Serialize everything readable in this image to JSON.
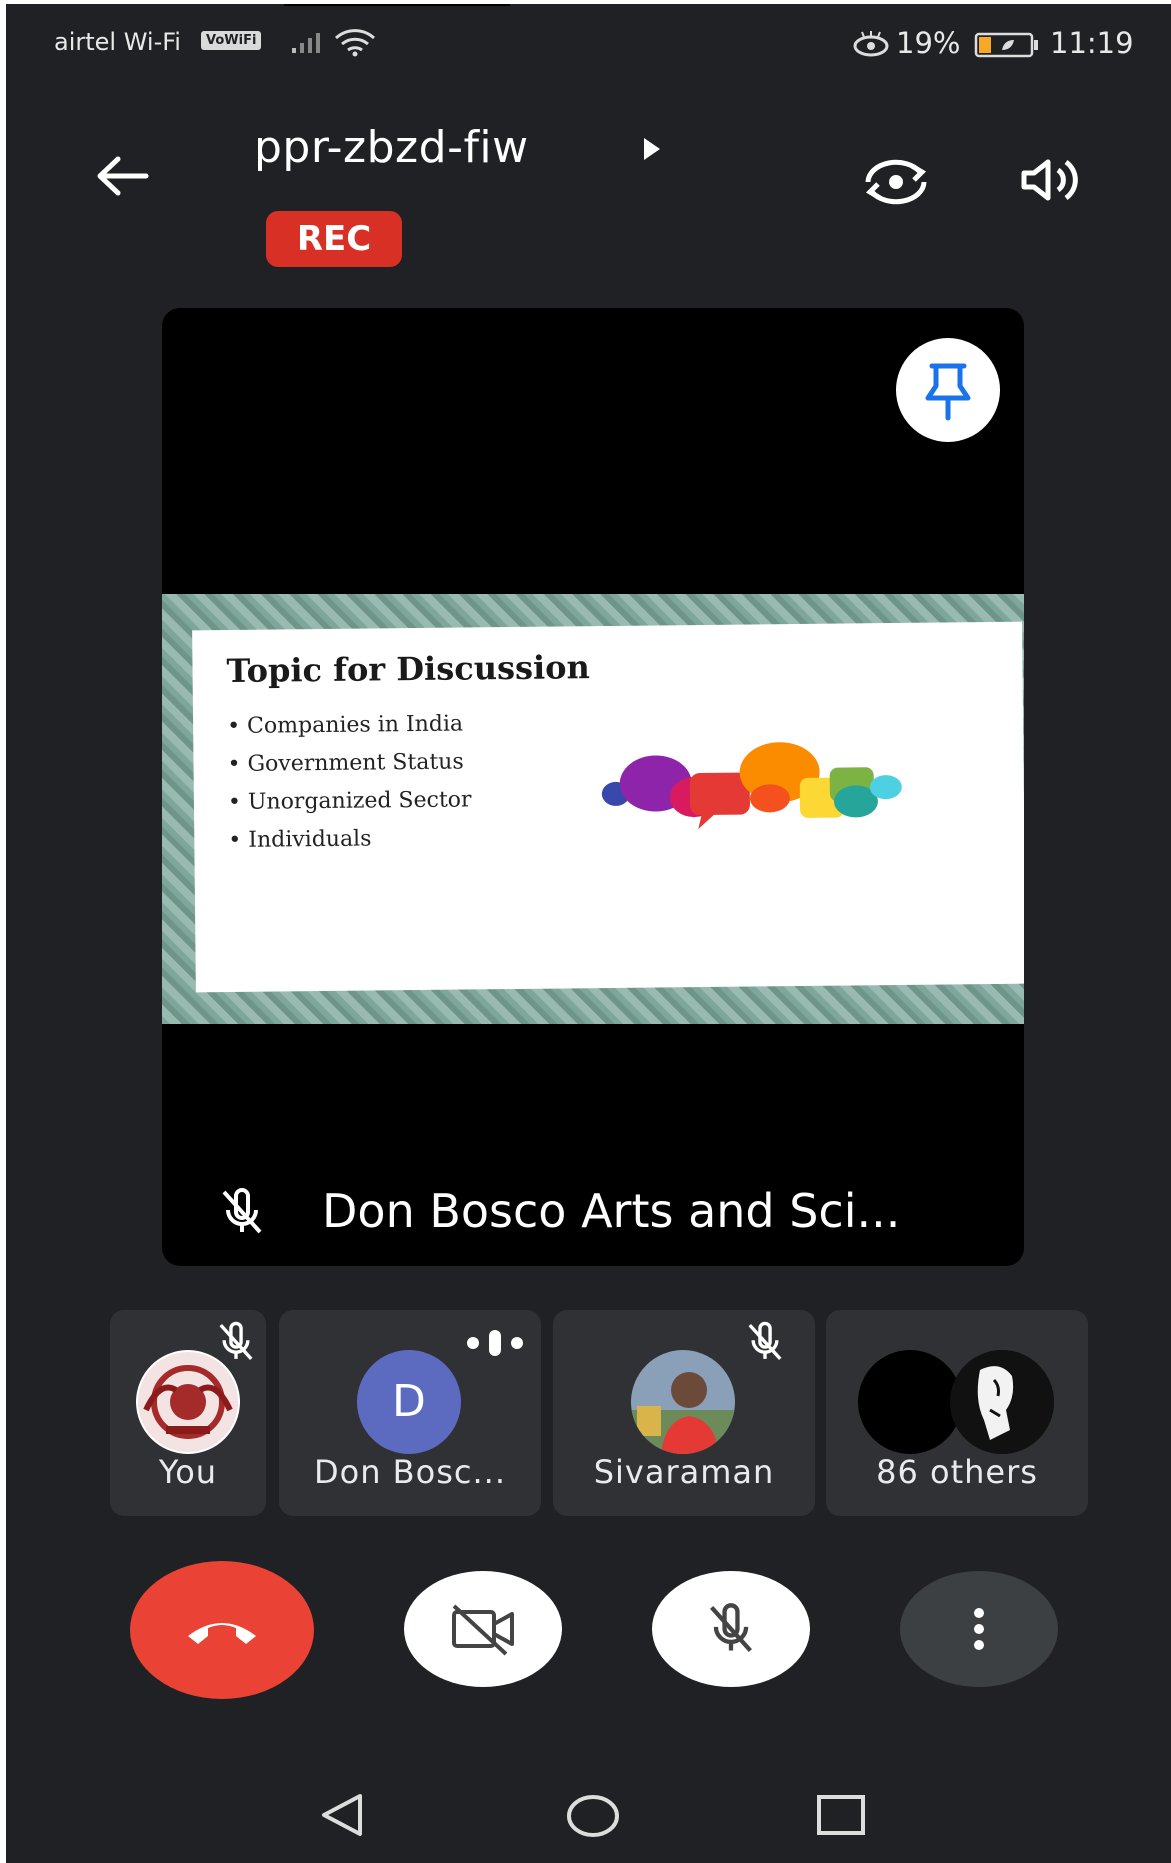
{
  "status_bar": {
    "carrier": "airtel Wi-Fi",
    "vowifi_badge": "VoWiFi",
    "battery_percent": "19%",
    "time": "11:19",
    "icons": [
      "signal-icon",
      "wifi-icon",
      "eye-comfort-icon",
      "battery-icon"
    ]
  },
  "header": {
    "meeting_code": "ppr-zbzd-fiw",
    "rec_badge": "REC",
    "icons": [
      "back-arrow-icon",
      "expand-arrow-icon",
      "switch-camera-icon",
      "speaker-icon"
    ]
  },
  "main_tile": {
    "presenter_name": "Don Bosco Arts and Sci...",
    "slide": {
      "title": "Topic for Discussion",
      "bullets": [
        "Companies in India",
        "Government Status",
        "Unorganized Sector",
        "Individuals"
      ]
    },
    "icons": [
      "pin-icon",
      "mic-off-icon"
    ]
  },
  "participants": [
    {
      "name": "You",
      "mic": "muted"
    },
    {
      "name": "Don Bosc...",
      "initial": "D",
      "mic": "speaking"
    },
    {
      "name": "Sivaraman",
      "mic": "muted"
    },
    {
      "name": "86 others"
    }
  ],
  "controls": {
    "icons": [
      "end-call-icon",
      "camera-off-icon",
      "mic-off-icon",
      "more-vert-icon"
    ],
    "colors": {
      "end_call": "#ea4335",
      "button_bg": "#ffffff",
      "more_bg": "#3c4043"
    }
  },
  "navigation": {
    "icons": [
      "nav-back-icon",
      "nav-home-icon",
      "nav-recents-icon"
    ]
  },
  "colors": {
    "background": "#202124",
    "tile": "#303134",
    "rec": "#d93025",
    "pin": "#1a73e8"
  }
}
